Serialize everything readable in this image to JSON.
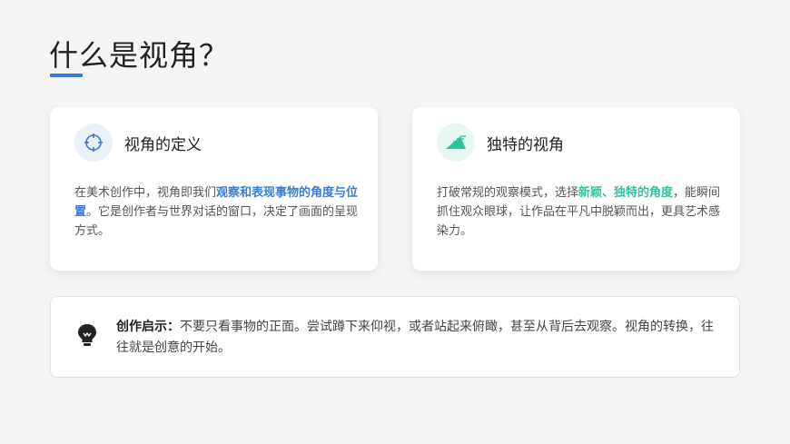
{
  "page": {
    "title": "什么是视角？",
    "accent_color": "#3a7bd5",
    "green_color": "#2ec4a0"
  },
  "cards": [
    {
      "icon": "crosshair-icon",
      "title": "视角的定义",
      "body_before": "在美术创作中，视角即我们",
      "body_highlight": "观察和表现事物的角度与位置",
      "body_after": "。它是创作者与世界对话的窗口，决定了画面的呈现方式。"
    },
    {
      "icon": "perspective-pyramid-icon",
      "title": "独特的视角",
      "body_before": "打破常规的观察模式，选择",
      "body_highlight": "新颖、独特的角度",
      "body_after": "，能瞬间抓住观众眼球，让作品在平凡中脱颖而出，更具艺术感染力。"
    }
  ],
  "tip": {
    "icon": "lightbulb-icon",
    "label": "创作启示：",
    "text": "不要只看事物的正面。尝试蹲下来仰视，或者站起来俯瞰，甚至从背后去观察。视角的转换，往往就是创意的开始。"
  }
}
